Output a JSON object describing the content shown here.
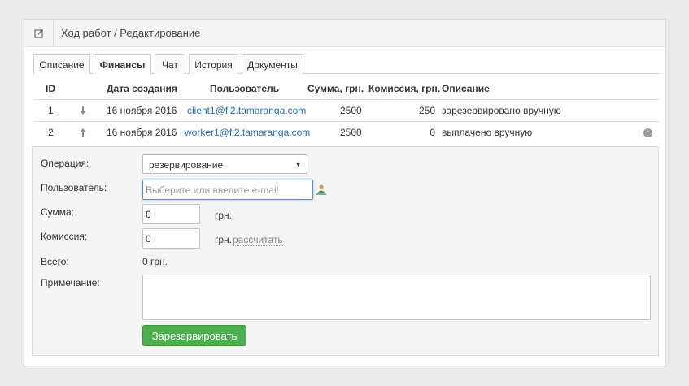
{
  "header": {
    "icon": "edit-icon",
    "title": "Ход работ / Редактирование"
  },
  "tabs": [
    {
      "label": "Описание",
      "active": false
    },
    {
      "label": "Финансы",
      "active": true
    },
    {
      "label": "Чат",
      "active": false
    },
    {
      "label": "История",
      "active": false
    },
    {
      "label": "Документы",
      "active": false
    }
  ],
  "table": {
    "columns": [
      "ID",
      "Дата создания",
      "Пользователь",
      "Сумма, грн.",
      "Комиссия, грн.",
      "Описание"
    ],
    "rows": [
      {
        "id": "1",
        "direction": "arrow-down-icon",
        "date": "16 ноября 2016",
        "user": "client1@fl2.tamaranga.com",
        "amount": "2500",
        "commission": "250",
        "description": "зарезервировано вручную",
        "info": false
      },
      {
        "id": "2",
        "direction": "arrow-up-icon",
        "date": "16 ноября 2016",
        "user": "worker1@fl2.tamaranga.com",
        "amount": "2500",
        "commission": "0",
        "description": "выплачено вручную",
        "info": true
      }
    ]
  },
  "form": {
    "operation_label": "Операция:",
    "operation_value": "резервирование",
    "user_label": "Пользователь:",
    "user_placeholder": "Выберите или введите e-mail",
    "user_value": "",
    "amount_label": "Сумма:",
    "amount_value": "0",
    "amount_unit": "грн.",
    "commission_label": "Комиссия:",
    "commission_value": "0",
    "commission_unit": "грн.",
    "calculate_link": "рассчитать",
    "total_label": "Всего:",
    "total_value": "0 грн.",
    "note_label": "Примечание:",
    "note_value": "",
    "submit_label": "Зарезервировать"
  },
  "colors": {
    "accent_link": "#2a6fb0",
    "submit_button": "#4cae4c",
    "background": "#ebebeb"
  }
}
